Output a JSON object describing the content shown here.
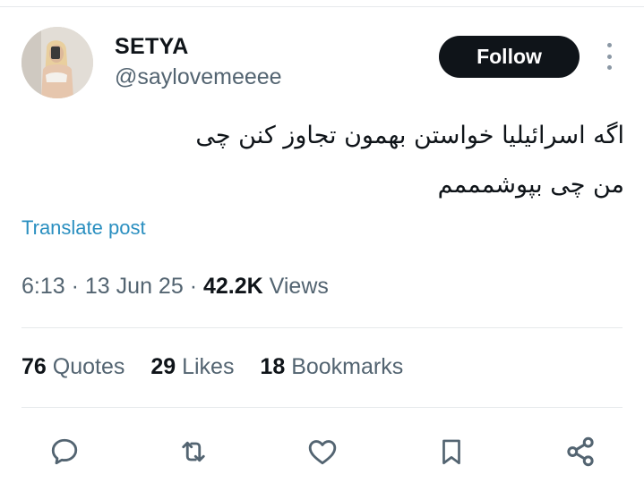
{
  "tweet": {
    "author_name": "SETYA",
    "author_handle": "@saylovemeeee",
    "follow_label": "Follow",
    "text_line1": "اگه اسرائیلیا خواستن بهمون تجاوز کنن چی",
    "text_line2": "من چی بپوشمممم",
    "translate_label": "Translate post",
    "time": "6:13",
    "date": "13 Jun 25",
    "views_count": "42.2K",
    "views_label": "Views"
  },
  "stats": {
    "quotes_count": "76",
    "quotes_label": "Quotes",
    "likes_count": "29",
    "likes_label": "Likes",
    "bookmarks_count": "18",
    "bookmarks_label": "Bookmarks"
  },
  "actions": [
    {
      "icon": "reply-icon"
    },
    {
      "icon": "retweet-icon"
    },
    {
      "icon": "like-icon"
    },
    {
      "icon": "bookmark-icon"
    },
    {
      "icon": "share-icon"
    }
  ],
  "colors": {
    "follow_button_bg": "#0f1419",
    "link": "#2a8fc0",
    "secondary_text": "#536471",
    "icon": "#536471"
  }
}
